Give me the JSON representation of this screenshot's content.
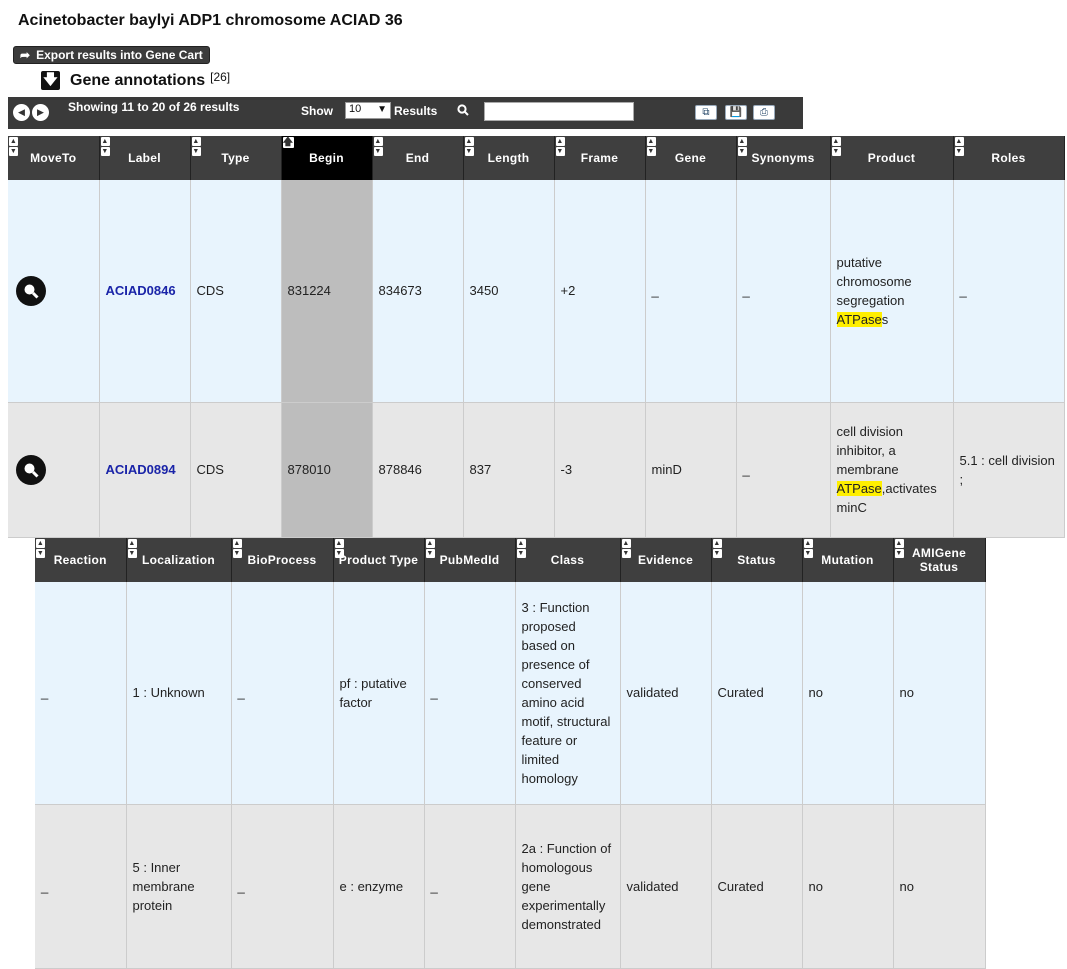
{
  "page_title": "Acinetobacter baylyi ADP1 chromosome ACIAD 36",
  "export_button": "Export results into Gene Cart",
  "section": {
    "title": "Gene annotations",
    "count": "[26]"
  },
  "toolbar": {
    "showing": "Showing 11 to 20 of 26 results",
    "show_label": "Show",
    "page_size": "10",
    "results_label": "Results",
    "search_placeholder": ""
  },
  "table1": {
    "headers": [
      "MoveTo",
      "Label",
      "Type",
      "Begin",
      "End",
      "Length",
      "Frame",
      "Gene",
      "Synonyms",
      "Product",
      "Roles"
    ],
    "rows": [
      {
        "label": "ACIAD0846",
        "type": "CDS",
        "begin": "831224",
        "end": "834673",
        "length": "3450",
        "frame": "+2",
        "gene": "_",
        "synonyms": "_",
        "product_pre": "putative chromosome segregation ",
        "product_hl": "ATPase",
        "product_post": "s",
        "roles": "_"
      },
      {
        "label": "ACIAD0894",
        "type": "CDS",
        "begin": "878010",
        "end": "878846",
        "length": "837",
        "frame": "-3",
        "gene": "minD",
        "synonyms": "_",
        "product_pre": "cell division inhibitor, a membrane ",
        "product_hl": "ATPase",
        "product_post": ",activates minC",
        "roles": "5.1 : cell division ;"
      }
    ]
  },
  "table2": {
    "headers": [
      "Reaction",
      "Localization",
      "BioProcess",
      "Product Type",
      "PubMedId",
      "Class",
      "Evidence",
      "Status",
      "Mutation",
      "AMIGene Status"
    ],
    "rows": [
      {
        "reaction": "_",
        "localization": "1 : Unknown",
        "bioprocess": "_",
        "product_type": "pf : putative factor",
        "pubmed": "_",
        "class": "3 : Function proposed based on presence of conserved amino acid motif, structural feature or limited homology",
        "evidence": "validated",
        "status": "Curated",
        "mutation": "no",
        "amigene": "no"
      },
      {
        "reaction": "_",
        "localization": "5 : Inner membrane protein",
        "bioprocess": "_",
        "product_type": "e : enzyme",
        "pubmed": "_",
        "class": "2a : Function of homologous gene experimentally demonstrated",
        "evidence": "validated",
        "status": "Curated",
        "mutation": "no",
        "amigene": "no"
      }
    ]
  }
}
